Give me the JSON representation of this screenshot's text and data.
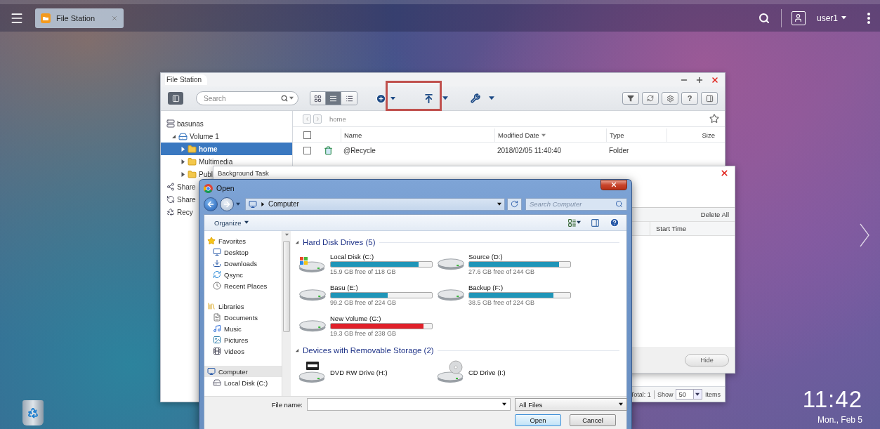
{
  "top_bar": {
    "app_tab": "File Station",
    "user": "user1"
  },
  "file_station": {
    "title": "File Station",
    "search": {
      "placeholder": "Search"
    },
    "view_modes": [
      {
        "kind": "grid",
        "selected": false
      },
      {
        "kind": "list",
        "selected": true
      },
      {
        "kind": "details",
        "selected": false
      }
    ],
    "help_label": "?",
    "tree": [
      {
        "label": "basunas",
        "kind": "nas",
        "selected": false,
        "children": [
          {
            "label": "Volume 1",
            "kind": "volume",
            "expanded": true,
            "selected": false,
            "children": [
              {
                "label": "home",
                "kind": "folder",
                "expanded": false,
                "selected": true
              },
              {
                "label": "Multimedia",
                "kind": "folder",
                "expanded": false,
                "selected": false
              },
              {
                "label": "Publ",
                "kind": "folder",
                "expanded": false,
                "selected": false
              }
            ]
          }
        ]
      },
      {
        "label": "Share",
        "kind": "share",
        "selected": false
      },
      {
        "label": "Share",
        "kind": "shared",
        "selected": false
      },
      {
        "label": "Recy",
        "kind": "recycle",
        "selected": false
      }
    ],
    "breadcrumb": "home",
    "columns": [
      {
        "label": "Name",
        "sorted": false
      },
      {
        "label": "Modified Date",
        "sorted": true
      },
      {
        "label": "Type",
        "sorted": false
      },
      {
        "label": "Size",
        "sorted": false
      }
    ],
    "header_checked": false,
    "rows": [
      {
        "name": "@Recycle",
        "modified": "2018/02/05 11:40:40",
        "type": "Folder",
        "checked": false
      }
    ],
    "status": {
      "total": "Total: 1",
      "show": "Show",
      "page_size": "50",
      "items": "Items"
    }
  },
  "background_task": {
    "title": "Background Task",
    "delete_all": "Delete All",
    "columns": [
      "Start Time"
    ],
    "hide": "Hide"
  },
  "open_dialog": {
    "title": "Open",
    "path": "Computer",
    "search_placeholder": "Search Computer",
    "organize": "Organize",
    "nav": [
      {
        "label": "Favorites",
        "kind": "favorites",
        "selected": false,
        "children": [
          {
            "label": "Desktop",
            "kind": "desktop",
            "selected": false
          },
          {
            "label": "Downloads",
            "kind": "downloads",
            "selected": false
          },
          {
            "label": "Qsync",
            "kind": "qsync",
            "selected": false
          },
          {
            "label": "Recent Places",
            "kind": "recent",
            "selected": false
          }
        ]
      },
      {
        "label": "Libraries",
        "kind": "libraries",
        "selected": false,
        "children": [
          {
            "label": "Documents",
            "kind": "documents",
            "selected": false
          },
          {
            "label": "Music",
            "kind": "music",
            "selected": false
          },
          {
            "label": "Pictures",
            "kind": "pictures",
            "selected": false
          },
          {
            "label": "Videos",
            "kind": "videos",
            "selected": false
          }
        ]
      },
      {
        "label": "Computer",
        "kind": "computer",
        "selected": true,
        "children": [
          {
            "label": "Local Disk (C:)",
            "kind": "drive",
            "selected": false
          }
        ]
      }
    ],
    "groups": [
      {
        "title": "Hard Disk Drives (5)",
        "expanded": true,
        "items": [
          {
            "kind": "system",
            "name": "Local Disk (C:)",
            "level": 0.87,
            "free": "15.9 GB free of 118 GB",
            "color": "#1f95b8"
          },
          {
            "kind": "hdd",
            "name": "Source (D:)",
            "level": 0.89,
            "free": "27.6 GB free of 244 GB",
            "color": "#1f95b8"
          },
          {
            "kind": "hdd",
            "name": "Basu (E:)",
            "level": 0.56,
            "free": "99.2 GB free of 224 GB",
            "color": "#1f95b8"
          },
          {
            "kind": "hdd",
            "name": "Backup (F:)",
            "level": 0.83,
            "free": "38.5 GB free of 224 GB",
            "color": "#1f95b8"
          },
          {
            "kind": "hdd",
            "name": "New Volume (G:)",
            "level": 0.92,
            "free": "19.3 GB free of 238 GB",
            "color": "#e0202a"
          }
        ]
      },
      {
        "title": "Devices with Removable Storage (2)",
        "expanded": true,
        "items": [
          {
            "kind": "dvd",
            "name": "DVD RW Drive (H:)"
          },
          {
            "kind": "cd",
            "name": "CD Drive (I:)"
          }
        ]
      }
    ],
    "file_name_label": "File name:",
    "file_type": "All Files",
    "open_button": "Open",
    "cancel_button": "Cancel"
  },
  "clock": {
    "time": "11:42",
    "date": "Mon., Feb 5"
  }
}
